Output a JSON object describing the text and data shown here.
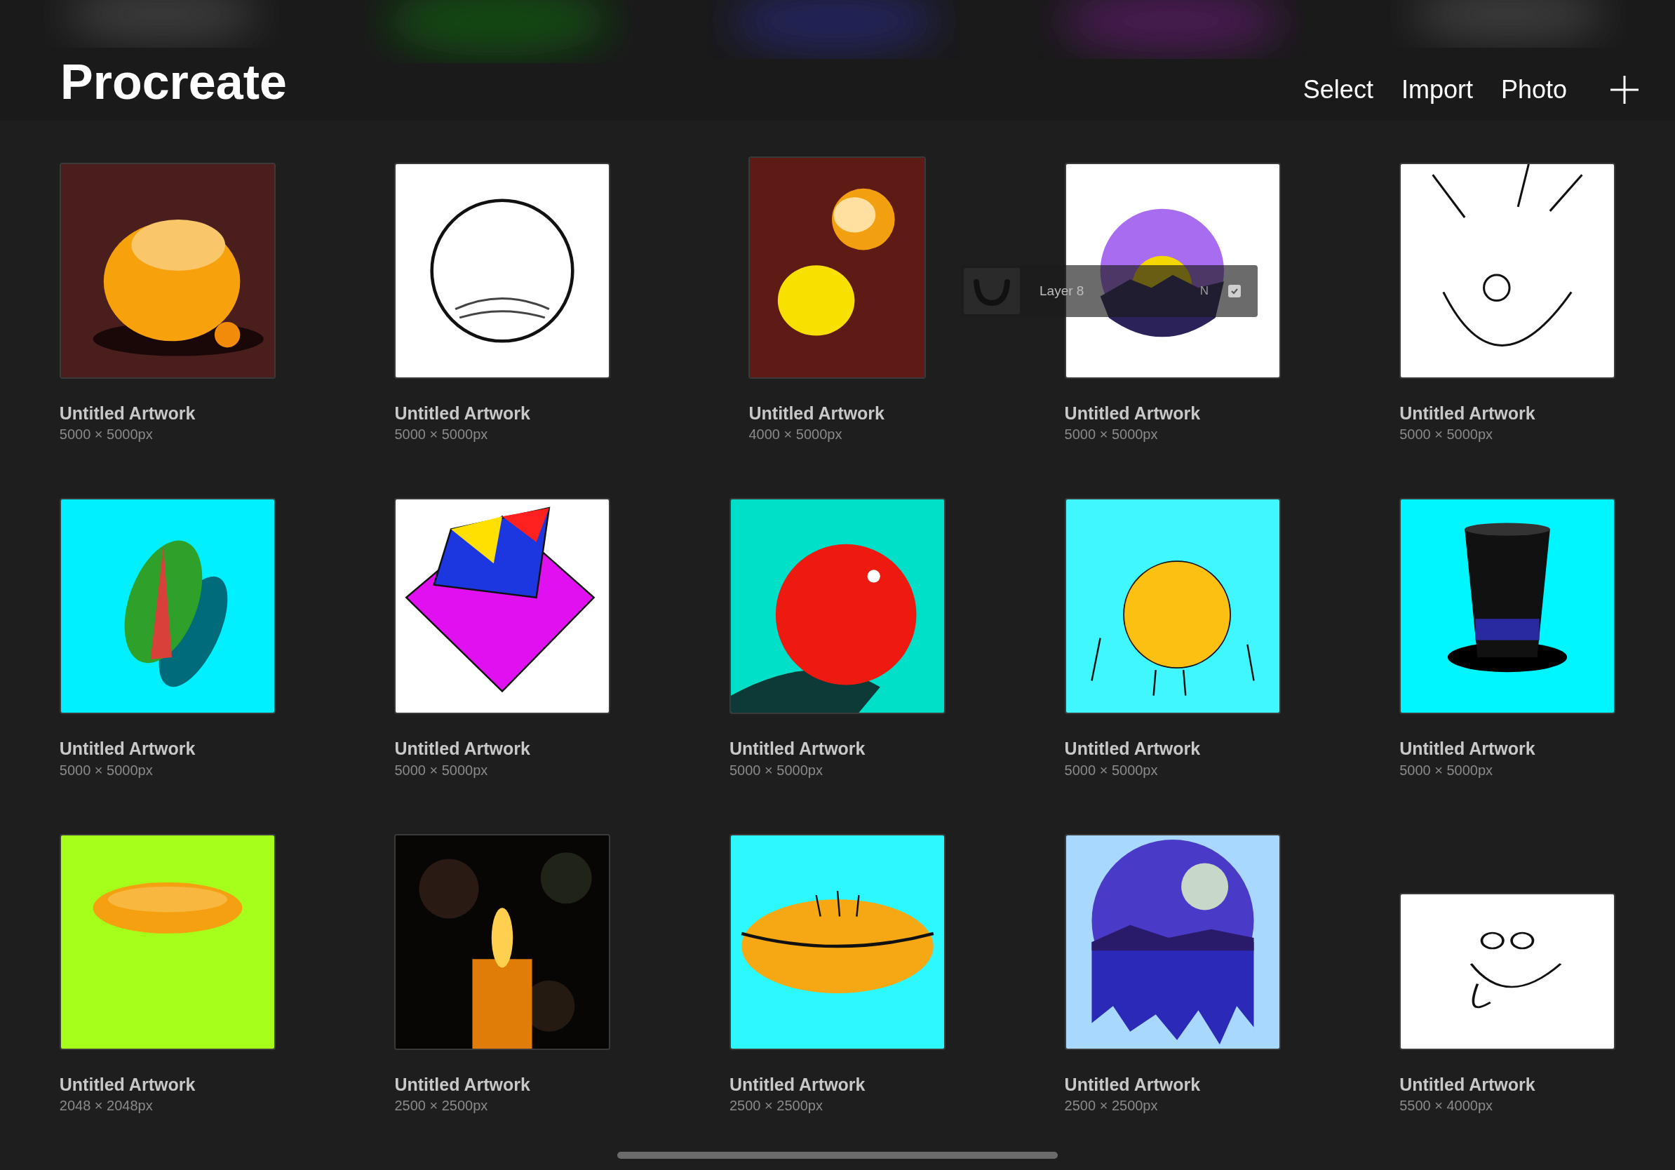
{
  "header": {
    "title": "Procreate",
    "actions": [
      {
        "kind": "text",
        "label": "Select"
      },
      {
        "kind": "text",
        "label": "Import"
      },
      {
        "kind": "text",
        "label": "Photo"
      },
      {
        "kind": "plus"
      }
    ]
  },
  "artworks": [
    {
      "title": "Untitled Artwork",
      "size": "5000 × 5000px",
      "kind": "square"
    },
    {
      "title": "Untitled Artwork",
      "size": "5000 × 5000px",
      "kind": "square"
    },
    {
      "title": "Untitled Artwork",
      "size": "4000 × 5000px",
      "kind": "portrait"
    },
    {
      "title": "Untitled Artwork",
      "size": "5000 × 5000px",
      "kind": "square"
    },
    {
      "title": "Untitled Artwork",
      "size": "5000 × 5000px",
      "kind": "square"
    },
    {
      "title": "Untitled Artwork",
      "size": "5000 × 5000px",
      "kind": "square"
    },
    {
      "title": "Untitled Artwork",
      "size": "5000 × 5000px",
      "kind": "square"
    },
    {
      "title": "Untitled Artwork",
      "size": "5000 × 5000px",
      "kind": "square"
    },
    {
      "title": "Untitled Artwork",
      "size": "5000 × 5000px",
      "kind": "square"
    },
    {
      "title": "Untitled Artwork",
      "size": "5000 × 5000px",
      "kind": "square"
    },
    {
      "title": "Untitled Artwork",
      "size": "2048 × 2048px",
      "kind": "square"
    },
    {
      "title": "Untitled Artwork",
      "size": "2500 × 2500px",
      "kind": "square"
    },
    {
      "title": "Untitled Artwork",
      "size": "2500 × 2500px",
      "kind": "square"
    },
    {
      "title": "Untitled Artwork",
      "size": "2500 × 2500px",
      "kind": "square"
    },
    {
      "title": "Untitled Artwork",
      "size": "5500 × 4000px",
      "kind": "landscape"
    }
  ],
  "dragged_layer": {
    "name": "Layer 8",
    "blend_mode": "N",
    "visible": true
  }
}
